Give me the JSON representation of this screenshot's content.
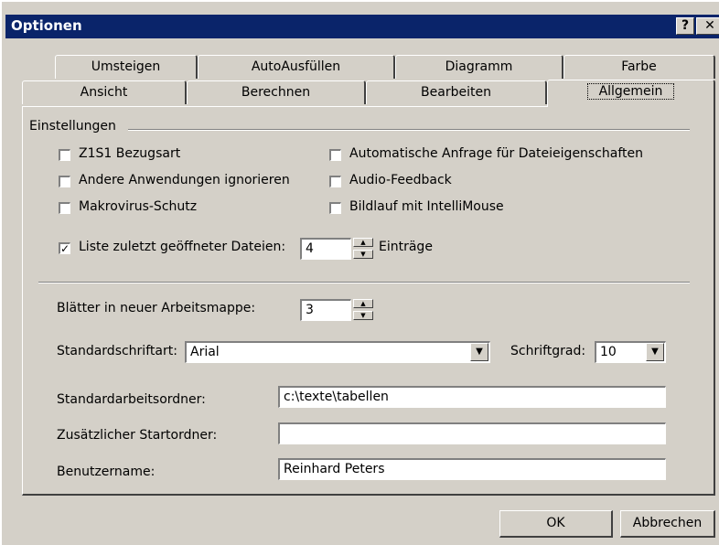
{
  "window": {
    "title": "Optionen",
    "help_glyph": "?",
    "close_glyph": "✕"
  },
  "tabs_back": [
    "Umsteigen",
    "AutoAusfüllen",
    "Diagramm",
    "Farbe"
  ],
  "tabs_front": [
    "Ansicht",
    "Berechnen",
    "Bearbeiten",
    "Allgemein"
  ],
  "selected_tab": "Allgemein",
  "group": {
    "title": "Einstellungen"
  },
  "options_left": [
    {
      "label": "Z1S1 Bezugsart",
      "checked": false
    },
    {
      "label": "Andere Anwendungen ignorieren",
      "checked": false
    },
    {
      "label": "Makrovirus-Schutz",
      "checked": false
    }
  ],
  "options_right": [
    {
      "label": "Automatische Anfrage für Dateieigenschaften",
      "checked": false
    },
    {
      "label": "Audio-Feedback",
      "checked": false
    },
    {
      "label": "Bildlauf mit IntelliMouse",
      "checked": false
    }
  ],
  "recent_files": {
    "label": "Liste zuletzt geöffneter Dateien:",
    "checked": true,
    "check_glyph": "✓",
    "value": "4",
    "suffix": "Einträge"
  },
  "sheets": {
    "label": "Blätter in neuer Arbeitsmappe:",
    "value": "3"
  },
  "font": {
    "label": "Standardschriftart:",
    "value": "Arial",
    "size_label": "Schriftgrad:",
    "size_value": "10"
  },
  "spin_glyphs": {
    "up": "▲",
    "down": "▼"
  },
  "dropdown_glyph": "▼",
  "work_folder": {
    "label": "Standardarbeitsordner:",
    "value": "c:\\texte\\tabellen"
  },
  "startup_folder": {
    "label": "Zusätzlicher Startordner:",
    "value": ""
  },
  "user_name": {
    "label": "Benutzername:",
    "value": "Reinhard Peters"
  },
  "buttons": {
    "ok": "OK",
    "cancel": "Abbrechen"
  }
}
